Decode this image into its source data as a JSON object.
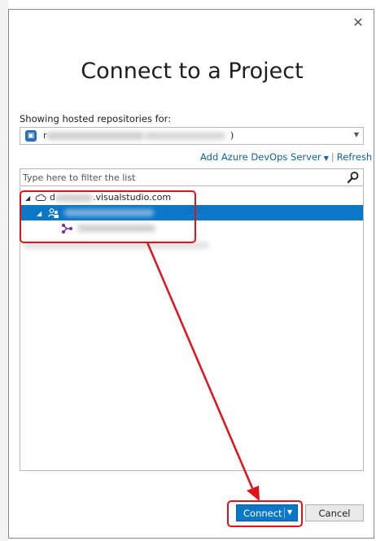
{
  "dialog": {
    "title": "Connect to a Project",
    "close_glyph": "✕"
  },
  "account": {
    "label": "Showing hosted repositories for:",
    "selected_suffix": ")",
    "icon": "account-badge-icon"
  },
  "links": {
    "add_server": "Add Azure DevOps Server",
    "separator": "|",
    "refresh": "Refresh"
  },
  "filter": {
    "placeholder": "Type here to filter the list",
    "icon": "search-icon"
  },
  "tree": {
    "server_suffix": ".visualstudio.com",
    "server_prefix": "d",
    "expander_glyph": "◢",
    "icons": [
      "cloud-icon",
      "team-project-icon",
      "git-repo-icon"
    ]
  },
  "buttons": {
    "connect": "Connect",
    "connect_caret": "▼",
    "cancel": "Cancel"
  },
  "colors": {
    "accent": "#0c76c7",
    "annotation": "#e0121a",
    "link": "#0e639c"
  }
}
